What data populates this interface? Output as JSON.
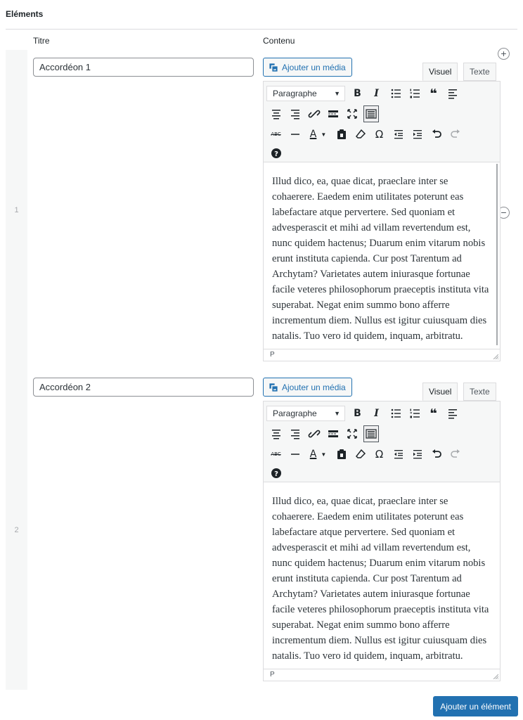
{
  "section": {
    "label": "Eléments"
  },
  "columns": {
    "title": "Titre",
    "content": "Contenu"
  },
  "editor_labels": {
    "add_media": "Ajouter un média",
    "tab_visual": "Visuel",
    "tab_text": "Texte",
    "format": "Paragraphe",
    "status_path": "P"
  },
  "rows": [
    {
      "number": "1",
      "title_value": "Accordéon 1",
      "content": "Illud dico, ea, quae dicat, praeclare inter se cohaerere. Eaedem enim utilitates poterunt eas labefactare atque pervertere. Sed quoniam et advesperascit et mihi ad villam revertendum est, nunc quidem hactenus; Duarum enim vitarum nobis erunt instituta capienda. Cur post Tarentum ad Archytam? Varietates autem iniurasque fortunae facile veteres philosophorum praeceptis instituta vita superabat. Negat enim summo bono afferre incrementum diem. Nullus est igitur cuiusquam dies natalis. Tuo vero id quidem, inquam, arbitratu."
    },
    {
      "number": "2",
      "title_value": "Accordéon 2",
      "content": "Illud dico, ea, quae dicat, praeclare inter se cohaerere. Eaedem enim utilitates poterunt eas labefactare atque pervertere. Sed quoniam et advesperascit et mihi ad villam revertendum est, nunc quidem hactenus; Duarum enim vitarum nobis erunt instituta capienda. Cur post Tarentum ad Archytam? Varietates autem iniurasque fortunae facile veteres philosophorum praeceptis instituta vita superabat. Negat enim summo bono afferre incrementum diem. Nullus est igitur cuiusquam dies natalis. Tuo vero id quidem, inquam, arbitratu."
    }
  ],
  "row_actions": {
    "add_symbol": "+",
    "remove_symbol": "−"
  },
  "footer": {
    "add_button": "Ajouter un élément"
  },
  "colors": {
    "accent": "#2271b1",
    "spellcheck": "#d63638"
  }
}
